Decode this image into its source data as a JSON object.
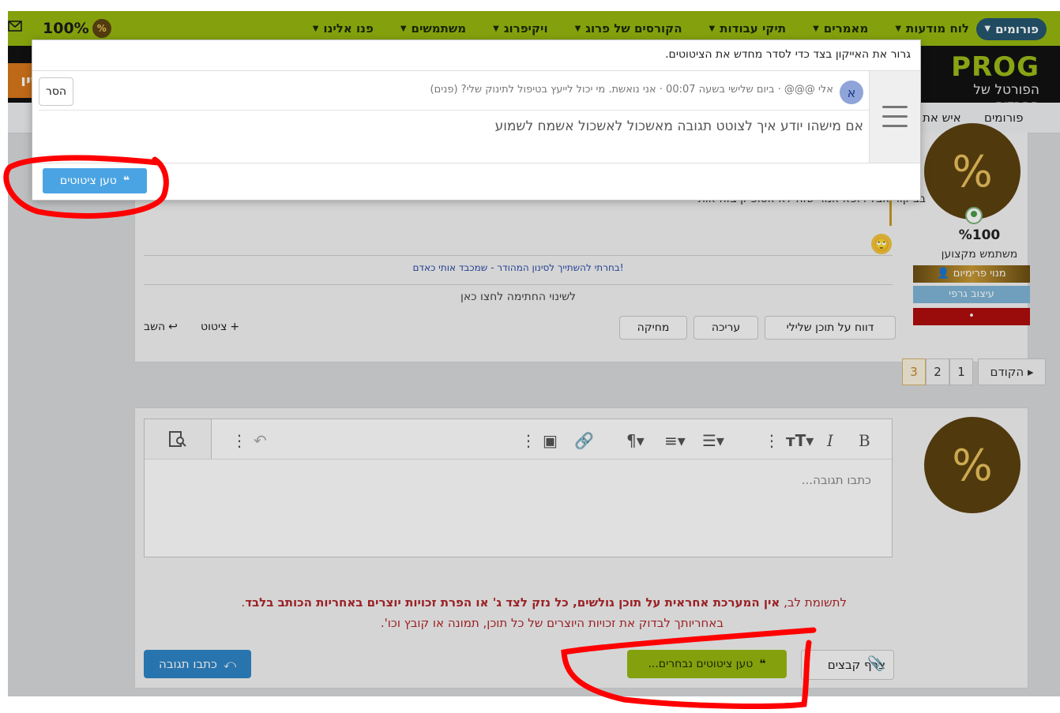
{
  "nav": {
    "forums": "פורומים",
    "items": [
      "לוח מודעות",
      "מאמרים",
      "תיקי עבודות",
      "הקורסים של פרוג",
      "ויקיפרוג",
      "משתמשים",
      "פנו אלינו"
    ],
    "percent": "100%",
    "percent_badge": "%"
  },
  "header": {
    "logo_word": "PROG",
    "logo_sub": "הפורטל של החרדים",
    "orange_text": "שיו"
  },
  "subnav": {
    "forums": "פורומים",
    "cut_item": "איש את"
  },
  "user": {
    "avatar_text": "%",
    "username": "%100",
    "title": "משתמש מקצוען",
    "banner_premium": "מנוי פרימיום",
    "banner_graphic": "עיצוב גרפי",
    "banner_red": "•"
  },
  "post": {
    "partial_text": "בביקור אבל רופא אמר שזה לא אטופיק בזה אות",
    "signature_link": "בחרתי להשתייך לסינון המהודר - שמכבד אותי כאדם!",
    "signature_change": "לשינוי החתימה לחצו כאן",
    "actions": {
      "report": "דווח על תוכן שלילי",
      "edit": "עריכה",
      "delete": "מחיקה",
      "quote": "ציטוט",
      "reply": "השב"
    }
  },
  "pagination": {
    "prev": "הקודם",
    "pages": [
      "1",
      "2",
      "3"
    ],
    "current": "3"
  },
  "reply": {
    "avatar_text": "%",
    "placeholder": "כתבו תגובה...",
    "warning_line1_prefix": "לתשומת לב, ",
    "warning_line1_bold": "אין המערכת אחראית על תוכן גולשים, כל נזק לצד ג' או הפרת זכויות יוצרים באחריות הכותב בלבד",
    "warning_line1_suffix": ".",
    "warning_line2": "באחריותך לבדוק את זכויות היוצרים של כל תוכן, תמונה או קובץ וכו'.",
    "attach_label": "צרף קבצים",
    "load_selected_label": "טען ציטוטים נבחרים...",
    "submit_label": "כתבו תגובה"
  },
  "modal": {
    "hint": "גרור את האייקון בצד כדי לסדר מחדש את הציטוטים.",
    "quote": {
      "avatar_letter": "א",
      "meta": "אלי @@@ · ביום שלישי בשעה 00:07 · אני נואשת. מי יכול לייעץ בטיפול לתינוק שלי? (פנים)",
      "body": "אם מישהו יודע איך לצוטט תגובה מאשכול לאשכול אשמח לשמוע"
    },
    "remove_label": "הסר",
    "load_quotes_label": "טען ציטוטים"
  },
  "colors": {
    "nav_green": "#97b80f",
    "forums_pill": "#25566f",
    "annotation_red": "#ff0000",
    "button_blue": "#2e84c6"
  }
}
